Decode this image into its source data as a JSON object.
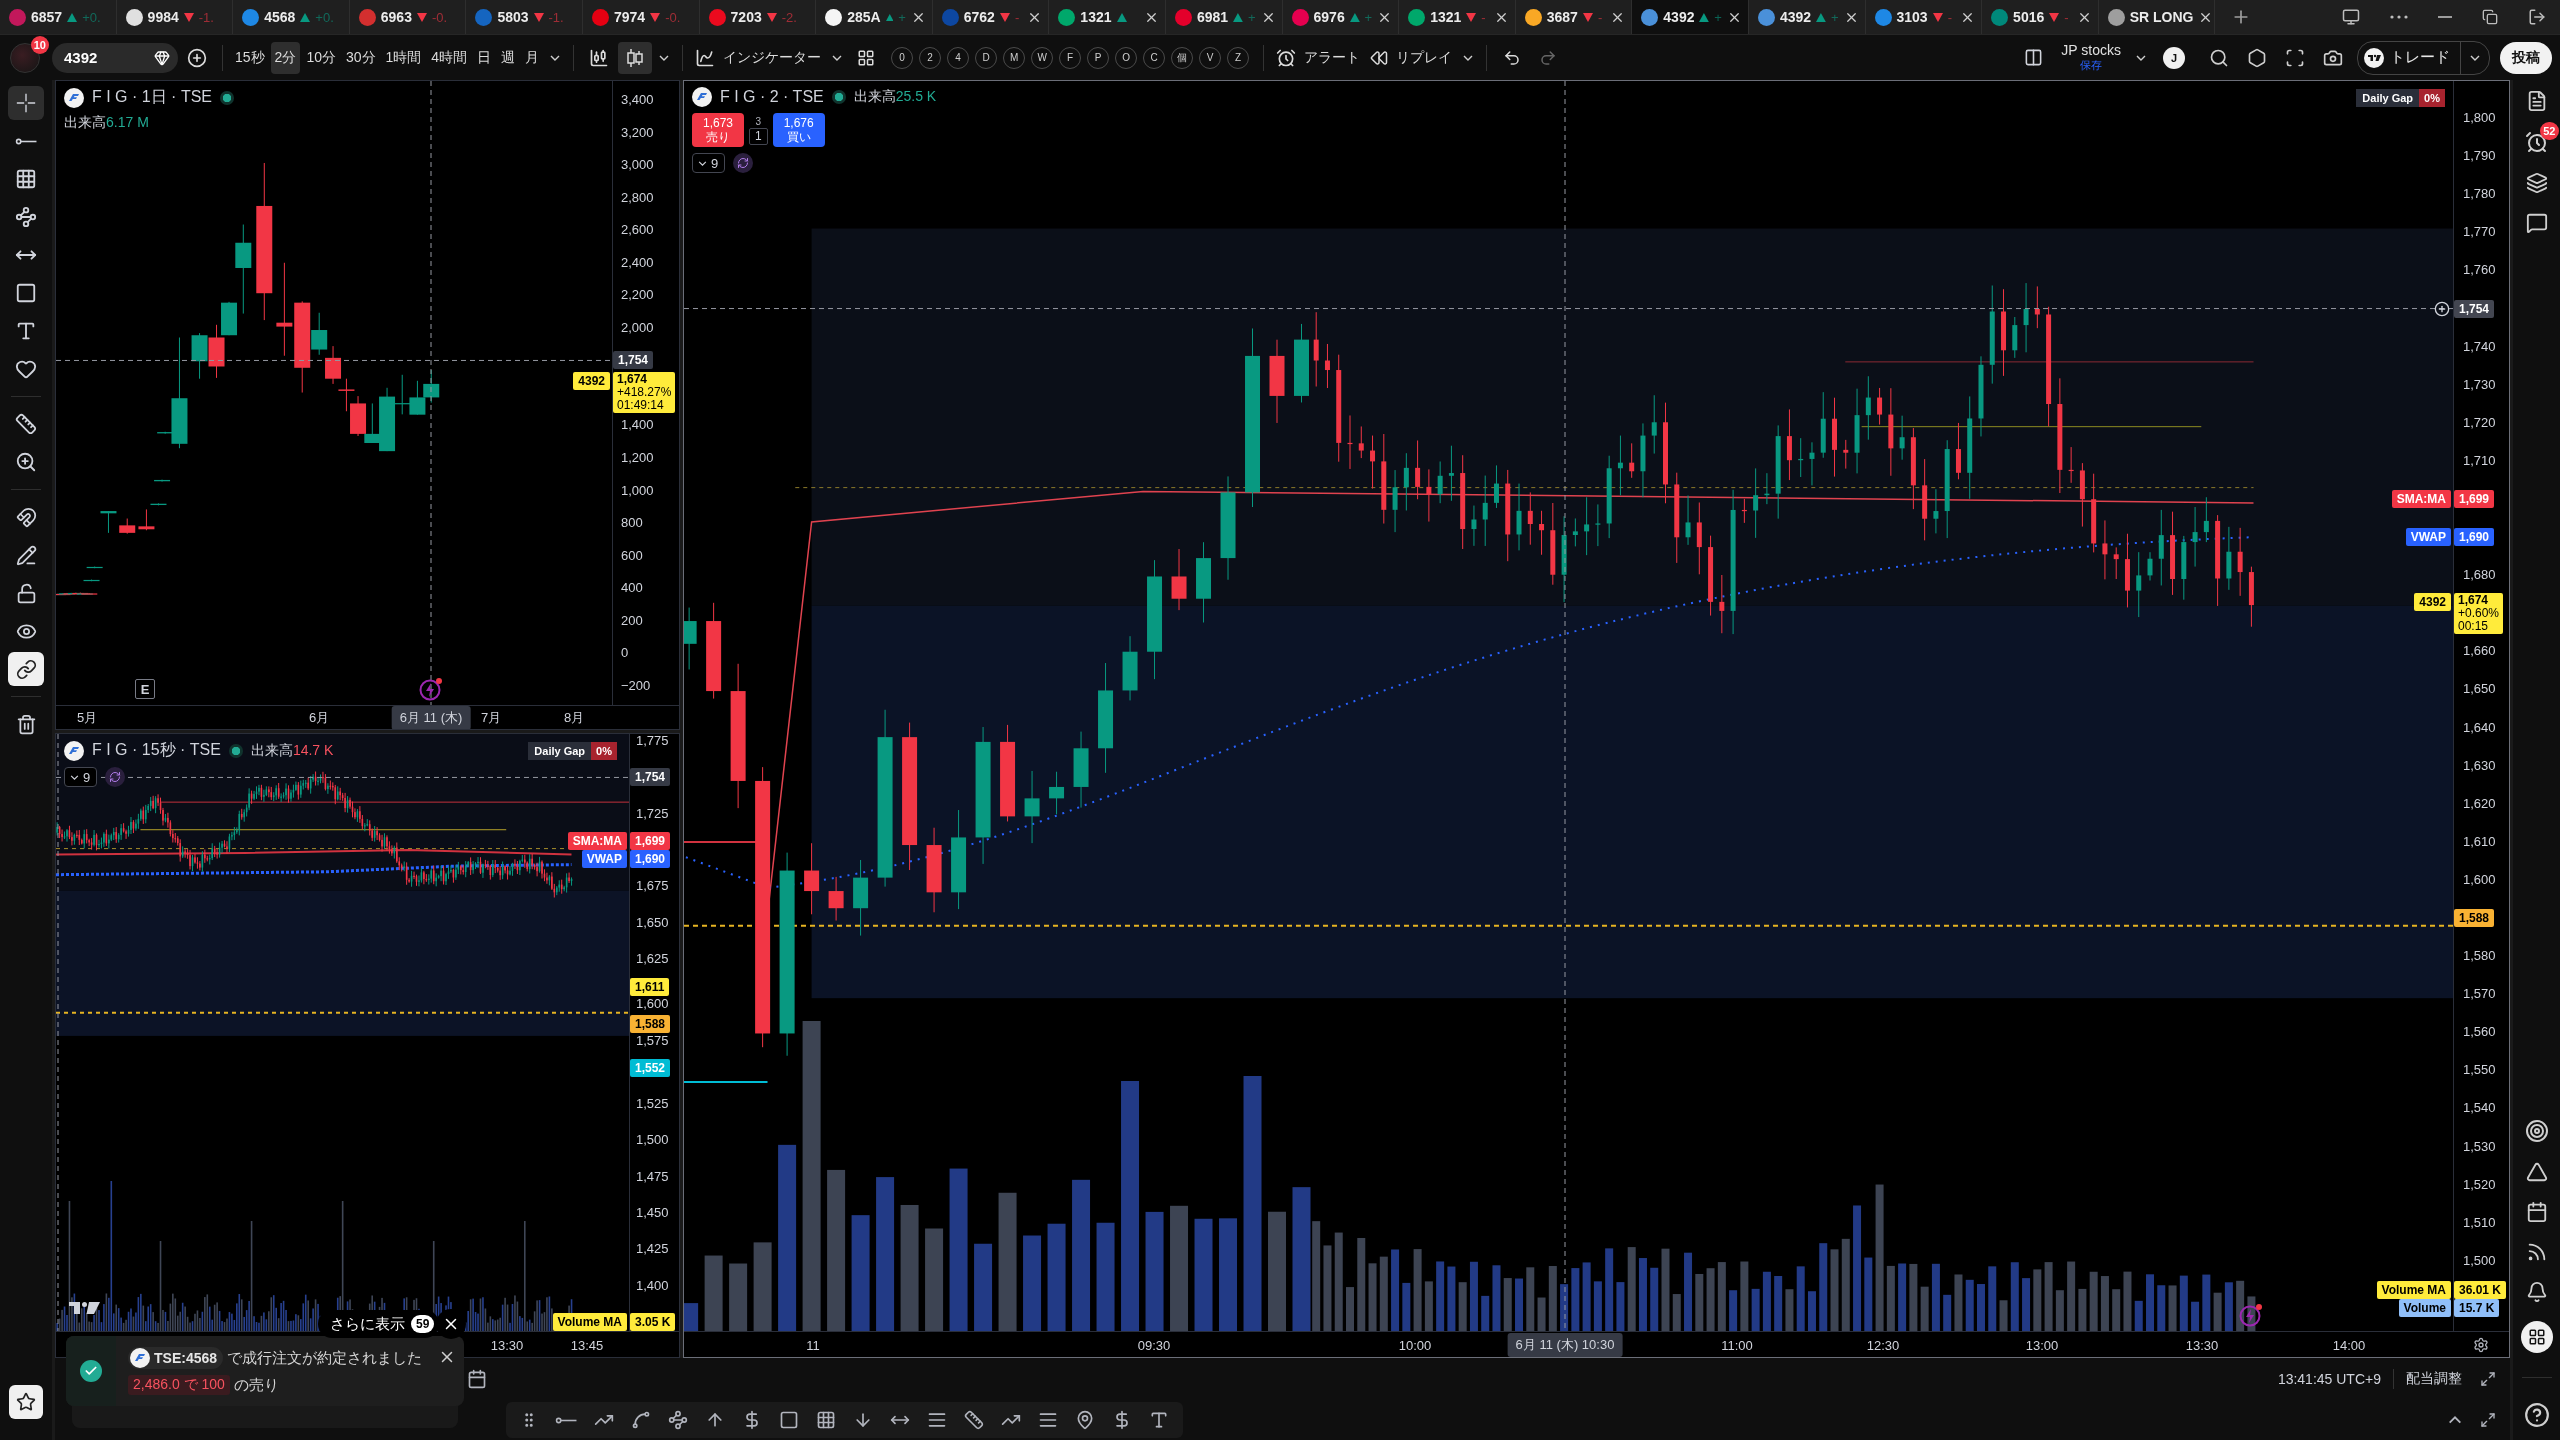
{
  "tabs": [
    {
      "code": "6857",
      "rising": true,
      "change": "+0.",
      "color": "#c2185b",
      "selected": false,
      "closable": false
    },
    {
      "code": "9984",
      "rising": false,
      "change": "-1.",
      "color": "#e0e0e0",
      "selected": false,
      "closable": false
    },
    {
      "code": "4568",
      "rising": true,
      "change": "+0.",
      "color": "#1e88e5",
      "selected": false,
      "closable": false
    },
    {
      "code": "6963",
      "rising": false,
      "change": "-0.",
      "color": "#d32f2f",
      "selected": false,
      "closable": false
    },
    {
      "code": "5803",
      "rising": false,
      "change": "-1.",
      "color": "#1565c0",
      "selected": false,
      "closable": false
    },
    {
      "code": "7974",
      "rising": false,
      "change": "-0.",
      "color": "#e60012",
      "selected": false,
      "closable": false
    },
    {
      "code": "7203",
      "rising": false,
      "change": "-2.",
      "color": "#eb0a1e",
      "selected": false,
      "closable": false
    },
    {
      "code": "285A",
      "rising": true,
      "change": "+",
      "color": "#f5f5f5",
      "selected": false,
      "closable": true
    },
    {
      "code": "6762",
      "rising": false,
      "change": "-",
      "color": "#0d47a1",
      "selected": false,
      "closable": true
    },
    {
      "code": "1321",
      "rising": true,
      "color": "#00a86b",
      "selected": false,
      "closable": true
    },
    {
      "code": "6981",
      "rising": true,
      "change": "+",
      "color": "#e4002b",
      "selected": false,
      "closable": true
    },
    {
      "code": "6976",
      "rising": true,
      "change": "+",
      "color": "#e5004f",
      "selected": false,
      "closable": true
    },
    {
      "code": "1321",
      "rising": false,
      "change": "-",
      "color": "#00a86b",
      "selected": false,
      "closable": true
    },
    {
      "code": "3687",
      "rising": false,
      "change": "-",
      "color": "#f9a825",
      "selected": false,
      "closable": true
    },
    {
      "code": "4392",
      "rising": true,
      "change": "+",
      "color": "#4a90d9",
      "selected": true,
      "closable": true
    },
    {
      "code": "4392",
      "rising": true,
      "change": "+",
      "color": "#4a90d9",
      "selected": false,
      "closable": true
    },
    {
      "code": "3103",
      "rising": false,
      "change": "-",
      "color": "#1e88e5",
      "selected": false,
      "closable": true
    },
    {
      "code": "5016",
      "rising": false,
      "change": "-",
      "color": "#00897b",
      "selected": false,
      "closable": true
    },
    {
      "code": "SR LONG",
      "color": "#9e9e9e",
      "selected": false,
      "closable": true
    }
  ],
  "toolbar": {
    "avatar_badge": "10",
    "symbol": "4392",
    "intervals": [
      {
        "label": "15秒",
        "selected": false
      },
      {
        "label": "2分",
        "selected": true
      },
      {
        "label": "10分",
        "selected": false
      },
      {
        "label": "30分",
        "selected": false
      },
      {
        "label": "1時間",
        "selected": false
      },
      {
        "label": "4時間",
        "selected": false
      },
      {
        "label": "日",
        "selected": false
      },
      {
        "label": "週",
        "selected": false
      },
      {
        "label": "月",
        "selected": false
      }
    ],
    "chart_styles": [
      {
        "selected": false
      },
      {
        "selected": true
      }
    ],
    "indicators_label": "インジケーター",
    "quick_keys": [
      "0",
      "2",
      "4",
      "D",
      "M",
      "W",
      "F",
      "P",
      "O",
      "C",
      "個",
      "V",
      "Z"
    ],
    "alert_label": "アラート",
    "replay_label": "リプレイ",
    "layout": {
      "name": "JP stocks",
      "status": "保存"
    },
    "user_initial": "J",
    "trade_label": "トレード",
    "publish_label": "投稿"
  },
  "left_toolbar": {
    "tools": [
      {
        "selected": true
      },
      {
        "selected": false
      },
      {
        "selected": false
      },
      {
        "selected": false
      },
      {
        "selected": false
      },
      {
        "selected": false
      },
      {
        "selected": false
      },
      {
        "selected": false
      },
      {
        "selected": false
      },
      {
        "selected": false
      }
    ],
    "toggles": [
      {
        "on": false
      },
      {
        "on": false
      },
      {
        "on": false
      },
      {
        "on": false
      },
      {
        "on": true
      }
    ]
  },
  "chart_daily": {
    "active": false,
    "legend": {
      "title": "F I G · 1日 · TSE",
      "market_open": true,
      "volume_label": "出来高",
      "volume_value": "6.17 M",
      "volume_rising": true
    },
    "earnings_marker": "E",
    "price_axis": [
      {
        "labels": [
          {
            "kind": "tick",
            "text": "3,400"
          }
        ]
      },
      {
        "labels": [
          {
            "kind": "tick",
            "text": "3,200"
          }
        ]
      },
      {
        "labels": [
          {
            "kind": "tick",
            "text": "3,000"
          }
        ]
      },
      {
        "labels": [
          {
            "kind": "tick",
            "text": "2,800"
          }
        ]
      },
      {
        "labels": [
          {
            "kind": "tick",
            "text": "2,600"
          }
        ]
      },
      {
        "labels": [
          {
            "kind": "tick",
            "text": "2,400"
          }
        ]
      },
      {
        "labels": [
          {
            "kind": "tick",
            "text": "2,200"
          }
        ]
      },
      {
        "labels": [
          {
            "kind": "tick",
            "text": "2,000"
          }
        ]
      },
      {
        "labels": [
          {
            "kind": "crosshair",
            "text": "1,754",
            "color": "#363a45"
          }
        ]
      },
      {
        "labels": [
          {
            "kind": "last",
            "symbol": "4392",
            "text": "1,674",
            "change": "+418.27%",
            "countdown": "01:49:14",
            "color": "#ffeb3b"
          }
        ]
      },
      {
        "labels": [
          {
            "kind": "tick",
            "text": "1,400"
          }
        ]
      },
      {
        "labels": [
          {
            "kind": "tick",
            "text": "1,200"
          }
        ]
      },
      {
        "labels": [
          {
            "kind": "tick",
            "text": "1,000"
          }
        ]
      },
      {
        "labels": [
          {
            "kind": "tick",
            "text": "800"
          }
        ]
      },
      {
        "labels": [
          {
            "kind": "tick",
            "text": "600"
          }
        ]
      },
      {
        "labels": [
          {
            "kind": "tick",
            "text": "400"
          }
        ]
      },
      {
        "labels": [
          {
            "kind": "tick",
            "text": "200"
          }
        ]
      },
      {
        "labels": [
          {
            "kind": "tick",
            "text": "0"
          }
        ]
      },
      {
        "labels": [
          {
            "kind": "tick",
            "text": "−200"
          }
        ]
      }
    ],
    "time_axis": [
      {
        "kind": "tick",
        "text": "5月"
      },
      {
        "kind": "tick",
        "text": "6月"
      },
      {
        "kind": "crosshair",
        "text": "6月 11 (木)"
      },
      {
        "kind": "tick",
        "text": "7月"
      },
      {
        "kind": "tick",
        "text": "8月"
      }
    ]
  },
  "chart_15s": {
    "active": false,
    "legend": {
      "title": "F I G · 15秒 · TSE",
      "market_open": true,
      "volume_label": "出来高",
      "volume_value": "14.7 K",
      "volume_rising": false
    },
    "indicators_toggle": "9",
    "daily_gap": {
      "label": "Daily Gap",
      "value": "0%"
    },
    "price_axis": [
      {
        "labels": [
          {
            "kind": "tick",
            "text": "1,775"
          }
        ]
      },
      {
        "labels": [
          {
            "kind": "crosshair",
            "text": "1,754",
            "color": "#363a45"
          }
        ]
      },
      {
        "labels": [
          {
            "kind": "tick",
            "text": "1,725"
          }
        ]
      },
      {
        "labels": [
          {
            "kind": "tag",
            "name": "SMA:MA",
            "text": "1,699",
            "color": "#f23645"
          },
          {
            "kind": "tag",
            "name": "VWAP",
            "text": "1,690",
            "color": "#2962ff"
          }
        ]
      },
      {
        "labels": [
          {
            "kind": "tick",
            "text": "1,675"
          }
        ]
      },
      {
        "labels": [
          {
            "kind": "tick",
            "text": "1,650"
          }
        ]
      },
      {
        "labels": [
          {
            "kind": "tick",
            "text": "1,625"
          }
        ]
      },
      {
        "labels": [
          {
            "kind": "tag",
            "text": "1,611",
            "color": "#ffeb3b"
          },
          {
            "kind": "tick",
            "text": "1,600"
          }
        ]
      },
      {
        "labels": [
          {
            "kind": "tag",
            "text": "1,588",
            "color": "#f9b233"
          },
          {
            "kind": "tick",
            "text": "1,575"
          }
        ]
      },
      {
        "labels": [
          {
            "kind": "tag",
            "text": "1,552",
            "color": "#00bcd4"
          }
        ]
      },
      {
        "labels": [
          {
            "kind": "tick",
            "text": "1,525"
          }
        ]
      },
      {
        "labels": [
          {
            "kind": "tick",
            "text": "1,500"
          }
        ]
      },
      {
        "labels": [
          {
            "kind": "tick",
            "text": "1,475"
          }
        ]
      },
      {
        "labels": [
          {
            "kind": "tick",
            "text": "1,450"
          }
        ]
      },
      {
        "labels": [
          {
            "kind": "tick",
            "text": "1,425"
          }
        ]
      },
      {
        "labels": [
          {
            "kind": "tick",
            "text": "1,400"
          }
        ]
      },
      {
        "labels": [
          {
            "kind": "tag",
            "name": "Volume MA",
            "text": "3.05 K",
            "color": "#ffeb3b"
          }
        ]
      }
    ],
    "time_axis": [
      {
        "kind": "tick",
        "text": "13:30"
      },
      {
        "kind": "tick",
        "text": "13:45"
      }
    ]
  },
  "chart_main": {
    "active": true,
    "legend": {
      "title": "F I G · 2 · TSE",
      "market_open": true,
      "volume_label": "出来高",
      "volume_value": "25.5 K",
      "volume_rising": true
    },
    "trade": {
      "sell_price": "1,673",
      "sell_label": "売り",
      "spread": "3",
      "quantity": "1",
      "buy_price": "1,676",
      "buy_label": "買い"
    },
    "indicators_toggle": "9",
    "daily_gap": {
      "label": "Daily Gap",
      "value": "0%"
    },
    "price_axis": [
      {
        "labels": [
          {
            "kind": "tick",
            "text": "1,800"
          }
        ]
      },
      {
        "labels": [
          {
            "kind": "tick",
            "text": "1,790"
          }
        ]
      },
      {
        "labels": [
          {
            "kind": "tick",
            "text": "1,780"
          }
        ]
      },
      {
        "labels": [
          {
            "kind": "tick",
            "text": "1,770"
          }
        ]
      },
      {
        "labels": [
          {
            "kind": "tick",
            "text": "1,760"
          }
        ]
      },
      {
        "labels": [
          {
            "kind": "crosshair",
            "text": "1,754",
            "color": "#434651",
            "add_button": true
          }
        ]
      },
      {
        "labels": [
          {
            "kind": "tick",
            "text": "1,740"
          }
        ]
      },
      {
        "labels": [
          {
            "kind": "tick",
            "text": "1,730"
          }
        ]
      },
      {
        "labels": [
          {
            "kind": "tick",
            "text": "1,720"
          }
        ]
      },
      {
        "labels": [
          {
            "kind": "tick",
            "text": "1,710"
          }
        ]
      },
      {
        "labels": [
          {
            "kind": "tag",
            "name": "SMA:MA",
            "text": "1,699",
            "color": "#f23645"
          }
        ]
      },
      {
        "labels": [
          {
            "kind": "tag",
            "name": "VWAP",
            "text": "1,690",
            "color": "#2962ff"
          }
        ]
      },
      {
        "labels": [
          {
            "kind": "tick",
            "text": "1,680"
          }
        ]
      },
      {
        "labels": [
          {
            "kind": "last",
            "symbol": "4392",
            "text": "1,674",
            "change": "+0.60%",
            "countdown": "00:15",
            "color": "#ffeb3b"
          }
        ]
      },
      {
        "labels": [
          {
            "kind": "tick",
            "text": "1,660"
          }
        ]
      },
      {
        "labels": [
          {
            "kind": "tick",
            "text": "1,650"
          }
        ]
      },
      {
        "labels": [
          {
            "kind": "tick",
            "text": "1,640"
          }
        ]
      },
      {
        "labels": [
          {
            "kind": "tick",
            "text": "1,630"
          }
        ]
      },
      {
        "labels": [
          {
            "kind": "tick",
            "text": "1,620"
          }
        ]
      },
      {
        "labels": [
          {
            "kind": "tick",
            "text": "1,610"
          }
        ]
      },
      {
        "labels": [
          {
            "kind": "tick",
            "text": "1,600"
          }
        ]
      },
      {
        "labels": [
          {
            "kind": "tag",
            "text": "1,588",
            "color": "#f9b233"
          }
        ]
      },
      {
        "labels": [
          {
            "kind": "tick",
            "text": "1,580"
          }
        ]
      },
      {
        "labels": [
          {
            "kind": "tick",
            "text": "1,570"
          }
        ]
      },
      {
        "labels": [
          {
            "kind": "tick",
            "text": "1,560"
          }
        ]
      },
      {
        "labels": [
          {
            "kind": "tick",
            "text": "1,550"
          }
        ]
      },
      {
        "labels": [
          {
            "kind": "tick",
            "text": "1,540"
          }
        ]
      },
      {
        "labels": [
          {
            "kind": "tick",
            "text": "1,530"
          }
        ]
      },
      {
        "labels": [
          {
            "kind": "tick",
            "text": "1,520"
          }
        ]
      },
      {
        "labels": [
          {
            "kind": "tick",
            "text": "1,510"
          }
        ]
      },
      {
        "labels": [
          {
            "kind": "tick",
            "text": "1,500"
          }
        ]
      },
      {
        "labels": [
          {
            "kind": "tag",
            "name": "Volume MA",
            "text": "36.01 K",
            "color": "#ffeb3b"
          },
          {
            "kind": "tag",
            "name": "Volume",
            "text": "15.7 K",
            "color": "#90bff9"
          }
        ]
      }
    ],
    "time_axis": [
      {
        "kind": "tick",
        "text": "11"
      },
      {
        "kind": "tick",
        "text": "09:30"
      },
      {
        "kind": "tick",
        "text": "10:00"
      },
      {
        "kind": "crosshair",
        "text": "6月 11 (木) 10:30"
      },
      {
        "kind": "tick",
        "text": "11:00"
      },
      {
        "kind": "tick",
        "text": "12:30"
      },
      {
        "kind": "tick",
        "text": "13:00"
      },
      {
        "kind": "tick",
        "text": "13:30"
      },
      {
        "kind": "tick",
        "text": "14:00"
      }
    ]
  },
  "right_sidebar": {
    "alerts_badge": "52"
  },
  "status_bar": {
    "time": "13:41:45 UTC+9",
    "adjustment": "配当調整"
  },
  "notifications": {
    "more_label": "さらに表示",
    "more_count": "59",
    "symbol": "TSE:4568",
    "message": "で成行注文が約定されました",
    "detail": "2,486.0 で 100",
    "suffix": "の売り"
  }
}
